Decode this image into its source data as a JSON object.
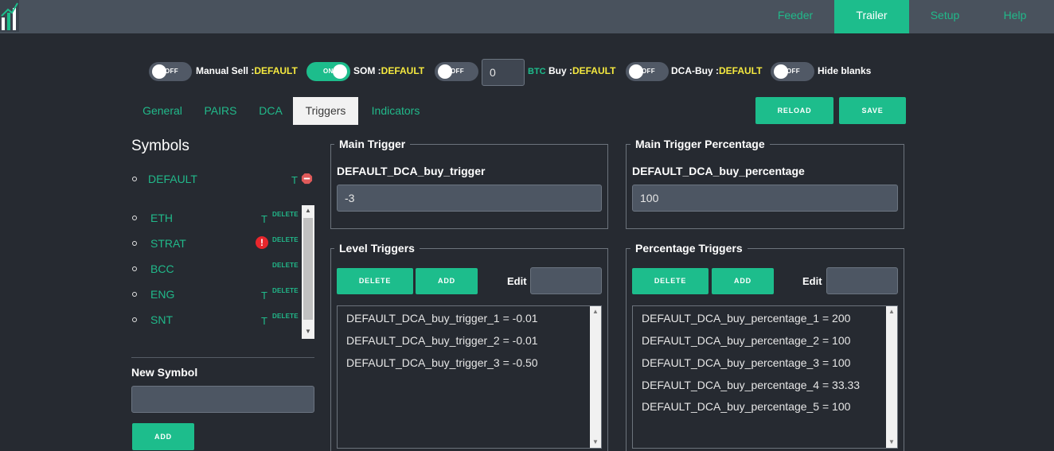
{
  "nav": {
    "items": [
      {
        "label": "Feeder",
        "active": false
      },
      {
        "label": "Trailer",
        "active": true
      },
      {
        "label": "Setup",
        "active": false
      },
      {
        "label": "Help",
        "active": false
      }
    ]
  },
  "toggles": {
    "manual_sell": {
      "state": "OFF",
      "label": "Manual Sell :",
      "value": "DEFAULT"
    },
    "som": {
      "state": "ON",
      "label": "SOM :",
      "value": "DEFAULT"
    },
    "btc_buy": {
      "state": "OFF",
      "input_value": "0",
      "currency": "BTC",
      "label": " Buy :",
      "value": "DEFAULT"
    },
    "dca_buy": {
      "state": "OFF",
      "label": "DCA-Buy :",
      "value": "DEFAULT"
    },
    "hide_blanks": {
      "state": "OFF",
      "label": "Hide blanks"
    }
  },
  "tabs": [
    {
      "label": "General",
      "active": false
    },
    {
      "label": "PAIRS",
      "active": false
    },
    {
      "label": "DCA",
      "active": false
    },
    {
      "label": "Triggers",
      "active": true
    },
    {
      "label": "Indicators",
      "active": false
    }
  ],
  "actions": {
    "reload": "RELOAD",
    "save": "SAVE"
  },
  "symbols": {
    "title": "Symbols",
    "default": {
      "name": "DEFAULT",
      "t": "T"
    },
    "items": [
      {
        "name": "ETH",
        "t": "T",
        "delete": "DELETE"
      },
      {
        "name": "STRAT",
        "t": "",
        "alert": "!",
        "delete": "DELETE"
      },
      {
        "name": "BCC",
        "t": "",
        "delete": "DELETE"
      },
      {
        "name": "ENG",
        "t": "T",
        "delete": "DELETE"
      },
      {
        "name": "SNT",
        "t": "T",
        "delete": "DELETE"
      }
    ],
    "new_symbol_label": "New Symbol",
    "new_symbol_value": "",
    "add_label": "ADD"
  },
  "main_trigger": {
    "legend": "Main Trigger",
    "field_label": "DEFAULT_DCA_buy_trigger",
    "value": "-3"
  },
  "main_trigger_percentage": {
    "legend": "Main Trigger Percentage",
    "field_label": "DEFAULT_DCA_buy_percentage",
    "value": "100"
  },
  "level_triggers": {
    "legend": "Level Triggers",
    "delete_label": "DELETE",
    "add_label": "ADD",
    "edit_label": "Edit",
    "edit_value": "",
    "items": [
      "DEFAULT_DCA_buy_trigger_1 = -0.01",
      "DEFAULT_DCA_buy_trigger_2 = -0.01",
      "DEFAULT_DCA_buy_trigger_3 = -0.50"
    ]
  },
  "percentage_triggers": {
    "legend": "Percentage Triggers",
    "delete_label": "DELETE",
    "add_label": "ADD",
    "edit_label": "Edit",
    "edit_value": "",
    "items": [
      "DEFAULT_DCA_buy_percentage_1 = 200",
      "DEFAULT_DCA_buy_percentage_2 = 100",
      "DEFAULT_DCA_buy_percentage_3 = 100",
      "DEFAULT_DCA_buy_percentage_4 = 33.33",
      "DEFAULT_DCA_buy_percentage_5 = 100"
    ]
  },
  "colors": {
    "accent": "#1dbd8c",
    "highlight": "#f5e93f",
    "background": "#262a31",
    "topbar": "#49525d"
  }
}
